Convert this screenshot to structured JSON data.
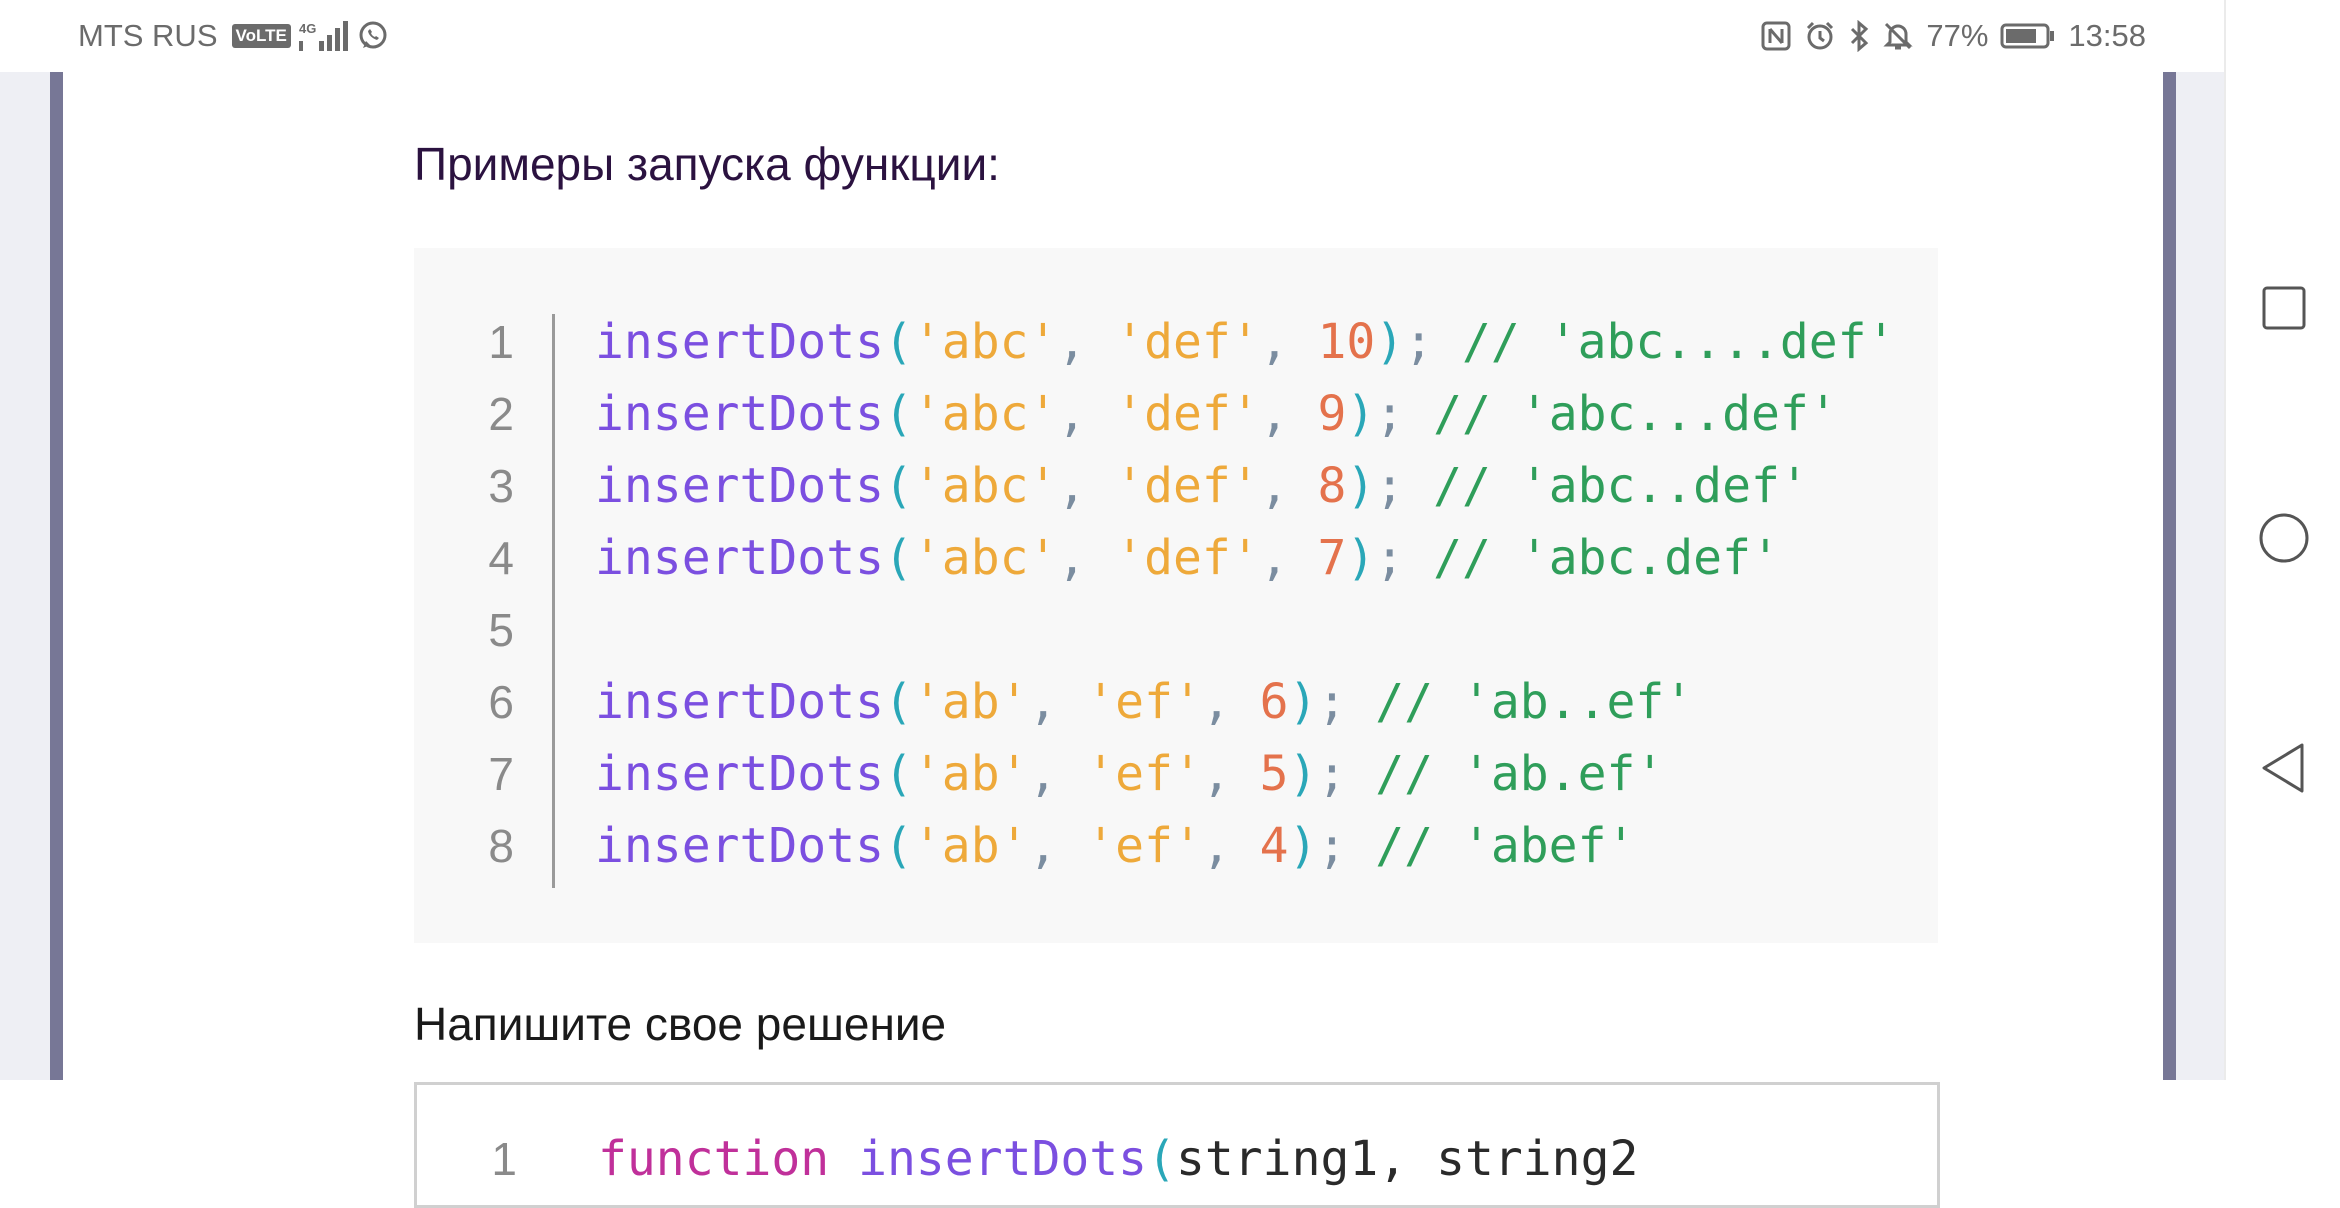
{
  "status_bar": {
    "carrier": "MTS RUS",
    "volte": "VoLTE",
    "network": "4G",
    "battery": "77%",
    "time": "13:58"
  },
  "content": {
    "heading": "Примеры запуска функции:",
    "examples": [
      {
        "ln": "1",
        "fn": "insertDots",
        "a": "'abc'",
        "b": "'def'",
        "n": "10",
        "comment": "// 'abc....def'"
      },
      {
        "ln": "2",
        "fn": "insertDots",
        "a": "'abc'",
        "b": "'def'",
        "n": "9",
        "comment": "// 'abc...def'"
      },
      {
        "ln": "3",
        "fn": "insertDots",
        "a": "'abc'",
        "b": "'def'",
        "n": "8",
        "comment": "// 'abc..def'"
      },
      {
        "ln": "4",
        "fn": "insertDots",
        "a": "'abc'",
        "b": "'def'",
        "n": "7",
        "comment": "// 'abc.def'"
      },
      {
        "ln": "5"
      },
      {
        "ln": "6",
        "fn": "insertDots",
        "a": "'ab'",
        "b": "'ef'",
        "n": "6",
        "comment": "// 'ab..ef'"
      },
      {
        "ln": "7",
        "fn": "insertDots",
        "a": "'ab'",
        "b": "'ef'",
        "n": "5",
        "comment": "// 'ab.ef'"
      },
      {
        "ln": "8",
        "fn": "insertDots",
        "a": "'ab'",
        "b": "'ef'",
        "n": "4",
        "comment": "// 'abef'"
      }
    ],
    "solution_heading": "Напишите свое решение",
    "editor": {
      "ln": "1",
      "keyword": "function",
      "fn": "insertDots",
      "params": "string1, string2"
    }
  },
  "colors": {
    "function": "#7b4fe0",
    "string": "#eea93a",
    "number": "#e4724c",
    "comment": "#2f9e5a",
    "paren": "#2aa7b8",
    "keyword": "#c0309a"
  },
  "nav": {
    "icons": [
      "recent-apps-icon",
      "home-icon",
      "back-icon"
    ]
  }
}
